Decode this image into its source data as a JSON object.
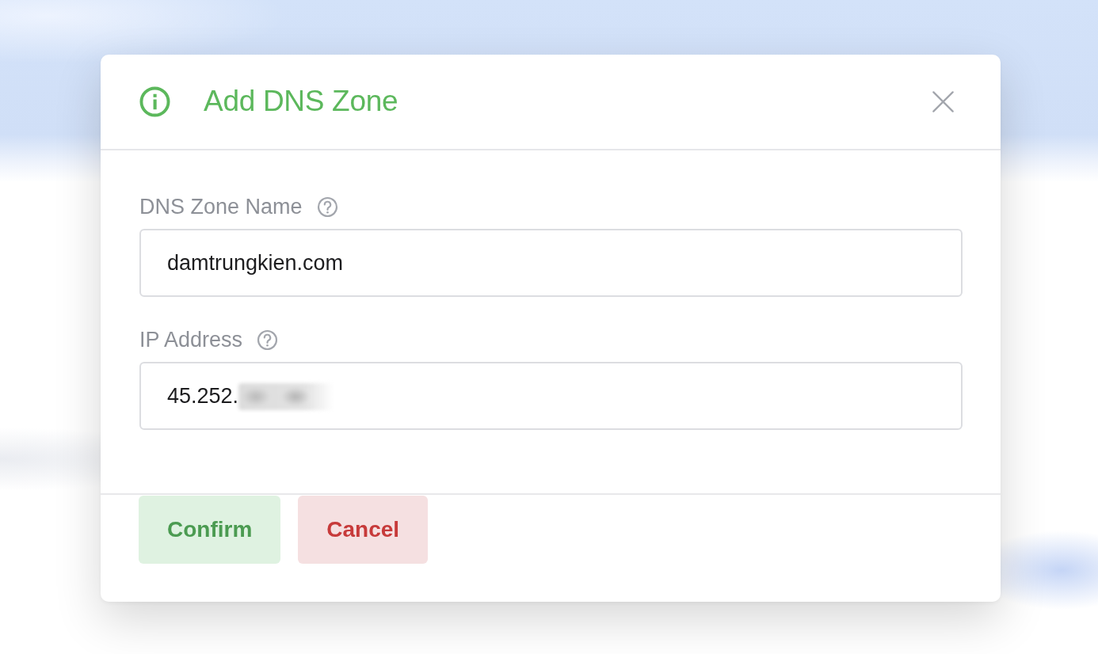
{
  "dialog": {
    "title": "Add DNS Zone",
    "fields": [
      {
        "label": "DNS Zone Name",
        "value": "damtrungkien.com",
        "redacted": false
      },
      {
        "label": "IP Address",
        "value": "45.252.",
        "redacted": true
      }
    ]
  },
  "buttons": [
    {
      "label": "Confirm",
      "kind": "confirm"
    },
    {
      "label": "Cancel",
      "kind": "cancel"
    }
  ]
}
